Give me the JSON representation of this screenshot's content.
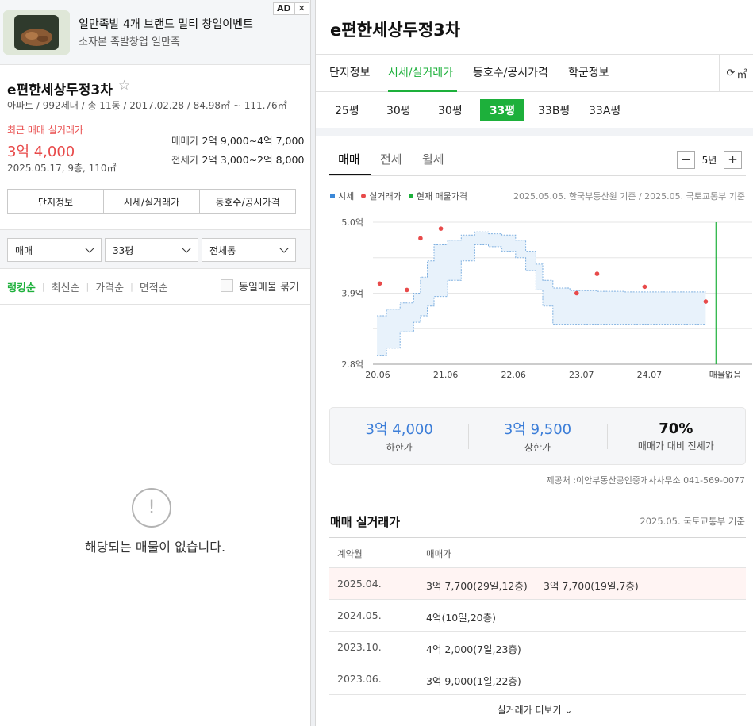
{
  "ad": {
    "badge": "AD",
    "close": "✕",
    "title": "일만족발 4개 브랜드 멀티 창업이벤트",
    "subtitle": "소자본 족발창업 일만족",
    "thumb_text": "소자본 족발창업"
  },
  "complex": {
    "name": "e편한세상두정3차",
    "star": "☆",
    "meta": "아파트 / 992세대 / 총 11동 / 2017.02.28 / 84.98㎡ ~ 111.76㎡",
    "recent_label": "최근 매매 실거래가",
    "recent_price": "3억 4,000",
    "recent_detail": "2025.05.17, 9층, 110㎡",
    "sale_label": "매매가",
    "sale_range": "2억 9,000~4억 7,000",
    "jeonse_label": "전세가",
    "jeonse_range": "2억 3,000~2억 8,000"
  },
  "left_buttons": [
    "단지정보",
    "시세/실거래가",
    "동호수/공시가격"
  ],
  "filters": [
    "매매",
    "33평",
    "전체동"
  ],
  "sorts": [
    "랭킹순",
    "최신순",
    "가격순",
    "면적순"
  ],
  "group_label": "동일매물 묶기",
  "empty": {
    "icon": "!",
    "text": "해당되는 매물이 없습니다."
  },
  "right": {
    "title": "e편한세상두정3차",
    "tabs": [
      "단지정보",
      "시세/실거래가",
      "동호수/공시가격",
      "학군정보"
    ],
    "refresh_label": "㎡",
    "sizes": [
      "25평",
      "30평",
      "30평",
      "33평",
      "33B평",
      "33A평"
    ],
    "deal_tabs": [
      "매매",
      "전세",
      "월세"
    ],
    "zoom": {
      "minus": "−",
      "label": "5년",
      "plus": "+"
    },
    "legend": [
      "시세",
      "실거래가",
      "현재 매물가격"
    ],
    "source": "2025.05.05. 한국부동산원 기준 / 2025.05. 국토교통부 기준",
    "summary": [
      {
        "value": "3억 4,000",
        "label": "하한가"
      },
      {
        "value": "3억 9,500",
        "label": "상한가"
      },
      {
        "value": "70%",
        "label": "매매가 대비 전세가"
      }
    ],
    "provider": "제공처 :이안부동산공인중개사사무소 041-569-0077",
    "trade_title": "매매 실거래가",
    "trade_source": "2025.05. 국토교통부 기준",
    "table_headers": [
      "계약월",
      "매매가"
    ],
    "rows": [
      {
        "date": "2025.04.",
        "p1": "3억 7,700(29일,12층)",
        "p2": "3억 7,700(19일,7층)"
      },
      {
        "date": "2024.05.",
        "p1": "4억(10일,20층)",
        "p2": ""
      },
      {
        "date": "2023.10.",
        "p1": "4억 2,000(7일,23층)",
        "p2": ""
      },
      {
        "date": "2023.06.",
        "p1": "3억 9,000(1일,22층)",
        "p2": ""
      }
    ],
    "more": "실거래가 더보기"
  },
  "colors": {
    "accent": "#1db03b",
    "price_red": "#e84a4a",
    "band_blue": "#7fb0e0",
    "trade_dot": "#e84a4a"
  },
  "chart_data": {
    "type": "area",
    "title": "",
    "y_ticks": [
      "2.8억",
      "3.9억",
      "5.0억"
    ],
    "ylim": [
      2.8,
      5.0
    ],
    "x_ticks": [
      "20.06",
      "21.06",
      "22.06",
      "23.07",
      "24.07",
      "매물없음"
    ],
    "xlim": [
      2020.3,
      2025.3
    ],
    "band": {
      "name": "시세",
      "upper": [
        [
          2020.36,
          3.55
        ],
        [
          2020.5,
          3.65
        ],
        [
          2020.7,
          3.75
        ],
        [
          2020.9,
          3.9
        ],
        [
          2021.0,
          4.15
        ],
        [
          2021.1,
          4.4
        ],
        [
          2021.2,
          4.65
        ],
        [
          2021.4,
          4.72
        ],
        [
          2021.6,
          4.8
        ],
        [
          2021.8,
          4.85
        ],
        [
          2022.0,
          4.82
        ],
        [
          2022.2,
          4.8
        ],
        [
          2022.4,
          4.72
        ],
        [
          2022.55,
          4.55
        ],
        [
          2022.7,
          4.35
        ],
        [
          2022.8,
          4.1
        ],
        [
          2022.95,
          3.98
        ],
        [
          2023.2,
          3.94
        ],
        [
          2023.6,
          3.93
        ],
        [
          2024.0,
          3.92
        ],
        [
          2024.6,
          3.92
        ],
        [
          2025.2,
          3.92
        ]
      ],
      "lower": [
        [
          2020.36,
          2.93
        ],
        [
          2020.5,
          3.05
        ],
        [
          2020.7,
          3.3
        ],
        [
          2020.9,
          3.45
        ],
        [
          2021.0,
          3.55
        ],
        [
          2021.1,
          3.7
        ],
        [
          2021.2,
          3.85
        ],
        [
          2021.4,
          4.1
        ],
        [
          2021.6,
          4.4
        ],
        [
          2021.8,
          4.65
        ],
        [
          2022.0,
          4.62
        ],
        [
          2022.2,
          4.55
        ],
        [
          2022.4,
          4.45
        ],
        [
          2022.55,
          4.25
        ],
        [
          2022.7,
          3.95
        ],
        [
          2022.8,
          3.7
        ],
        [
          2022.95,
          3.42
        ],
        [
          2023.2,
          3.42
        ],
        [
          2023.6,
          3.42
        ],
        [
          2024.0,
          3.42
        ],
        [
          2024.6,
          3.42
        ],
        [
          2025.2,
          3.42
        ]
      ]
    },
    "trades": [
      [
        2020.4,
        4.05
      ],
      [
        2020.8,
        3.95
      ],
      [
        2021.0,
        4.75
      ],
      [
        2021.3,
        4.9
      ],
      [
        2023.3,
        3.9
      ],
      [
        2023.6,
        4.2
      ],
      [
        2024.3,
        4.0
      ],
      [
        2025.2,
        3.77
      ]
    ],
    "current_line_x": 2025.35,
    "grid": true
  }
}
